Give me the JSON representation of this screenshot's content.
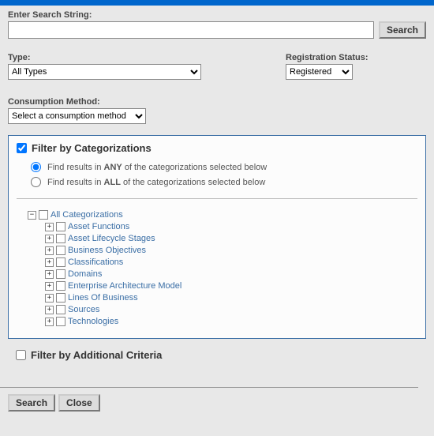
{
  "search": {
    "label": "Enter Search String:",
    "value": "",
    "button": "Search"
  },
  "type": {
    "label": "Type:",
    "selected": "All Types"
  },
  "registration": {
    "label": "Registration Status:",
    "selected": "Registered"
  },
  "consumption": {
    "label": "Consumption Method:",
    "selected": "Select a consumption method"
  },
  "categorizations": {
    "enabled": true,
    "title": "Filter by Categorizations",
    "mode": "any",
    "anyLabelPre": "Find results in ",
    "anyLabelBold": "ANY",
    "anyLabelPost": " of the categorizations selected below",
    "allLabelPre": "Find results in ",
    "allLabelBold": "ALL",
    "allLabelPost": " of the categorizations selected below",
    "root": {
      "label": "All Categorizations",
      "expanded": true,
      "children": [
        {
          "label": "Asset Functions"
        },
        {
          "label": "Asset Lifecycle Stages"
        },
        {
          "label": "Business Objectives"
        },
        {
          "label": "Classifications"
        },
        {
          "label": "Domains"
        },
        {
          "label": "Enterprise Architecture Model"
        },
        {
          "label": "Lines Of Business"
        },
        {
          "label": "Sources"
        },
        {
          "label": "Technologies"
        }
      ]
    }
  },
  "additionalCriteria": {
    "enabled": false,
    "title": "Filter by Additional Criteria"
  },
  "footer": {
    "search": "Search",
    "close": "Close"
  }
}
